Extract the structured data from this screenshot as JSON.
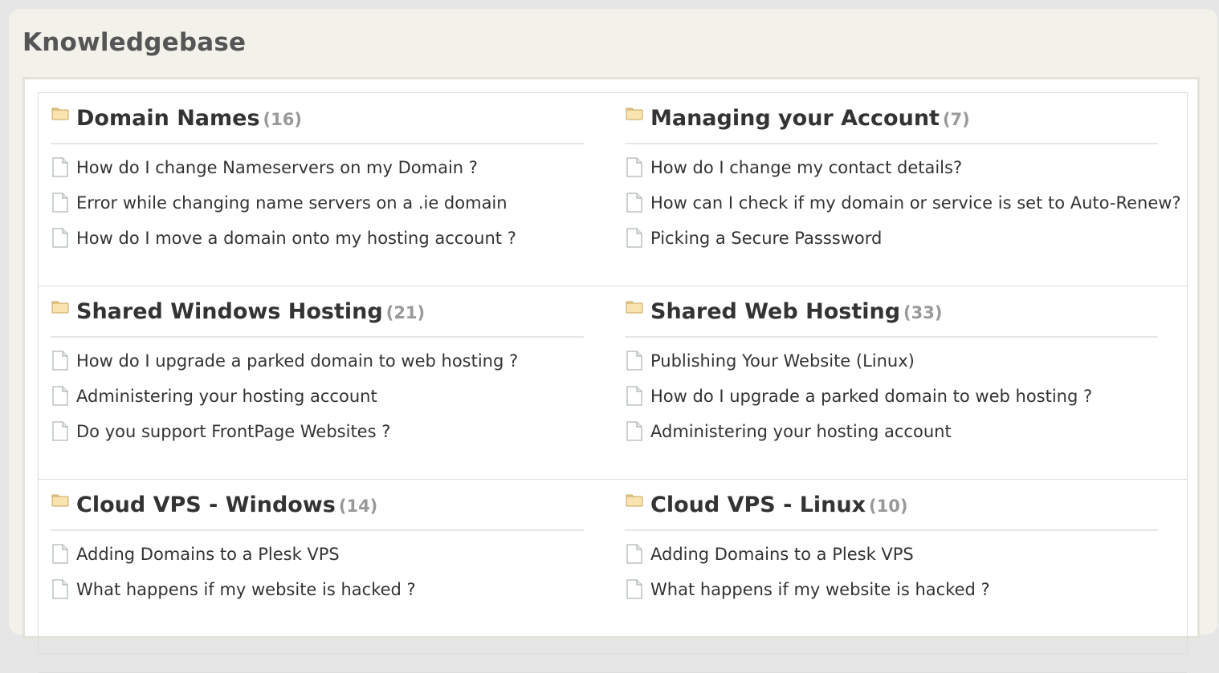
{
  "page": {
    "title": "Knowledgebase"
  },
  "icons": {
    "category": "folder-icon",
    "article": "document-icon"
  },
  "categories": [
    {
      "title": "Domain Names",
      "count": "(16)",
      "articles": [
        "How do I change Nameservers on my Domain ?",
        "Error while changing name servers on a .ie domain",
        "How do I move a domain onto my hosting account ?"
      ]
    },
    {
      "title": "Managing your Account",
      "count": "(7)",
      "articles": [
        "How do I change my contact details?",
        "How can I check if my domain or service is set to Auto-Renew?",
        "Picking a Secure Passsword"
      ]
    },
    {
      "title": "Shared Windows Hosting",
      "count": "(21)",
      "articles": [
        "How do I upgrade a parked domain to web hosting ?",
        "Administering your hosting account",
        "Do you support FrontPage Websites ?"
      ]
    },
    {
      "title": "Shared Web Hosting",
      "count": "(33)",
      "articles": [
        "Publishing Your Website (Linux)",
        "How do I upgrade a parked domain to web hosting ?",
        "Administering your hosting account"
      ]
    },
    {
      "title": "Cloud VPS - Windows",
      "count": "(14)",
      "articles": [
        "Adding Domains to a Plesk VPS",
        "What happens if my website is hacked ?"
      ]
    },
    {
      "title": "Cloud VPS - Linux",
      "count": "(10)",
      "articles": [
        "Adding Domains to a Plesk VPS",
        "What happens if my website is hacked ?"
      ]
    }
  ]
}
